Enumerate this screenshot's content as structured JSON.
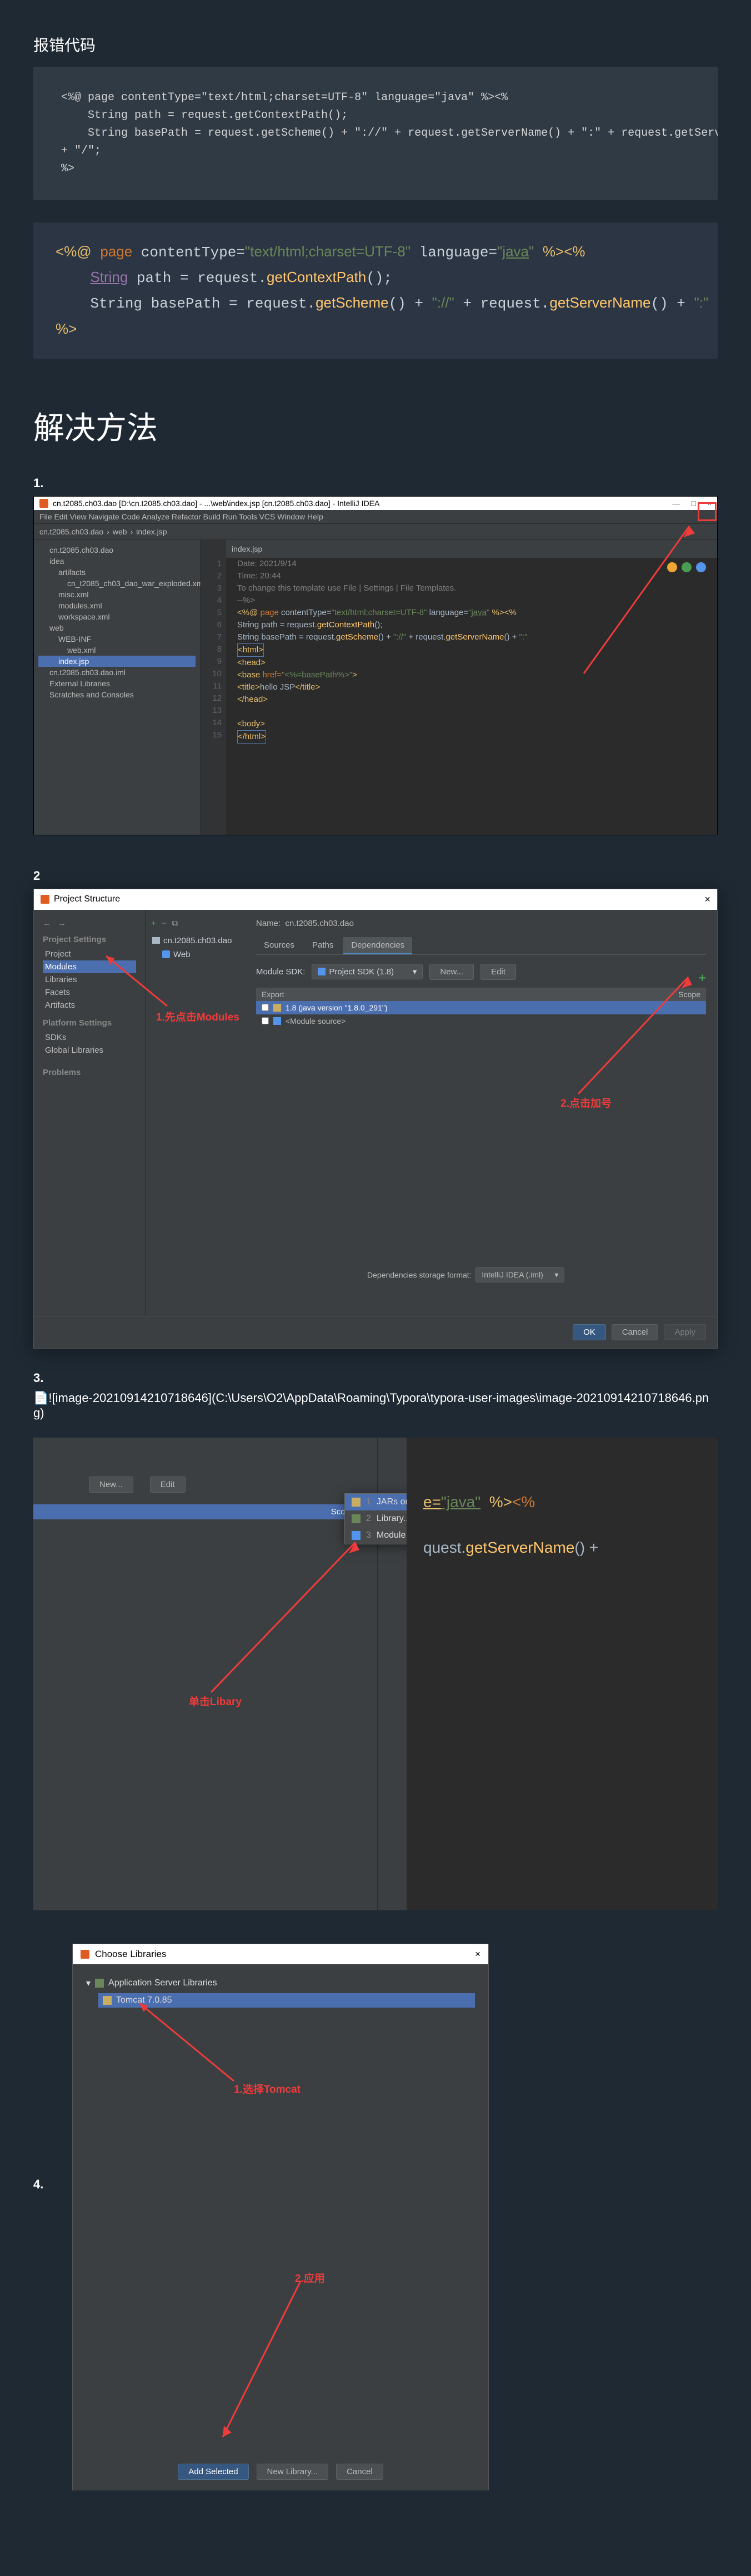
{
  "header_label": "报错代码",
  "code1": "<%@ page contentType=\"text/html;charset=UTF-8\" language=\"java\" %><%\n    String path = request.getContextPath();\n    String basePath = request.getScheme() + \"://\" + request.getServerName() + \":\" + request.getServerPort() + path\n+ \"/\";\n%>",
  "code2_html": "<span class='tag'>&lt;%@</span> <span class='kw'>page</span> contentType=<span class='str'>\"text/html;charset=UTF-8\"</span> language=<span class='str'>\"<u>java</u>\"</span> <span class='tag'>%&gt;</span><span class='tag'>&lt;%</span>\n    <span class='id'>String</span> path = request.<span class='fn'>getContextPath</span>();\n    String basePath = request.<span class='fn'>getScheme</span>() + <span class='str'>\"://\"</span> + request.<span class='fn'>getServerName</span>() + <span class='str'>\":\"</span>\n<span class='tag'>%&gt;</span>",
  "solution_title": "解决方法",
  "steps": {
    "s1": "1.",
    "s2": "2",
    "s3": "3.",
    "s4": "4."
  },
  "ide": {
    "title": "cn.t2085.ch03.dao [D:\\cn.t2085.ch03.dao] - ...\\web\\index.jsp [cn.t2085.ch03.dao] - IntelliJ IDEA",
    "menu": "File  Edit  View  Navigate  Code  Analyze  Refactor  Build  Run  Tools  VCS  Window  Help",
    "tab": "index.jsp",
    "tree": [
      "cn.t2085.ch03.dao",
      "idea",
      "artifacts",
      "cn_t2085_ch03_dao_war_exploded.xml",
      "misc.xml",
      "modules.xml",
      "workspace.xml",
      "web",
      "WEB-INF",
      "web.xml",
      "index.jsp",
      "cn.t2085.ch03.dao.iml",
      "External Libraries",
      "Scratches and Consoles"
    ],
    "gutter": [
      "1",
      "2",
      "3",
      "4",
      "5",
      "6",
      "7",
      "8",
      "9",
      "10",
      "11",
      "12",
      "13",
      "14",
      "15"
    ],
    "lines": [
      "<span class='cm'>Date: 2021/9/14</span>",
      "<span class='cm'>Time: 20:44</span>",
      "<span class='cm'>To change this template use File | Settings | File Templates.</span>",
      "<span class='cm'>--%&gt;</span>",
      "<span class='tag'>&lt;%@</span> <span class='kw'>page</span> contentType=<span class='str'>\"text/html;charset=UTF-8\"</span> language=<span class='str'>\"<u>java</u>\"</span> <span class='tag'>%&gt;&lt;%</span>",
      "    String path = request.<span class='fn'>getContextPath</span>();",
      "    String basePath = request.<span class='fn'>getScheme</span>() + <span class='str'>\"://\"</span> + request.<span class='fn'>getServerName</span>() + <span class='str'>\":\"</span>",
      "<span class='box'><span class='tag'>&lt;html&gt;</span></span>",
      "<span class='tag'>&lt;head&gt;</span>",
      "    <span class='tag'>&lt;base</span> <span class='kw'>href=</span><span class='str'>\"&lt;%=basePath%&gt;\"</span><span class='tag'>&gt;</span>",
      "    <span class='tag'>&lt;title&gt;</span>hello JSP<span class='tag'>&lt;/title&gt;</span>",
      "<span class='tag'>&lt;/head&gt;</span>",
      "",
      "<span class='tag'>&lt;body&gt;</span>",
      "<span class='box'><span class='tag'>&lt;/html&gt;</span></span>"
    ]
  },
  "ps": {
    "title": "Project Structure",
    "nav_settings": "Project Settings",
    "nav": [
      "Project",
      "Modules",
      "Libraries",
      "Facets",
      "Artifacts"
    ],
    "nav_platform": "Platform Settings",
    "nav2": [
      "SDKs",
      "Global Libraries"
    ],
    "nav_problems": "Problems",
    "module": "cn.t2085.ch03.dao",
    "module_sub": "Web",
    "name_label": "Name:",
    "name_val": "cn.t2085.ch03.dao",
    "tabs": [
      "Sources",
      "Paths",
      "Dependencies"
    ],
    "sdk_label": "Module SDK:",
    "sdk_val": "Project SDK (1.8)",
    "new": "New...",
    "edit": "Edit",
    "export": "Export",
    "scope": "Scope",
    "dep1": "1.8 (java version \"1.8.0_291\")",
    "dep2": "<Module source>",
    "storage": "Dependencies storage format:",
    "storage_val": "IntelliJ IDEA (.iml)",
    "ok": "OK",
    "cancel": "Cancel",
    "apply": "Apply",
    "anno1": "1.先点击Modules",
    "anno2": "2.点击加号"
  },
  "s3": {
    "imgtext": "![image-20210914210718646](C:\\Users\\O2\\AppData\\Roaming\\Typora\\typora-user-images\\image-20210914210718646.png)",
    "new": "New...",
    "edit": "Edit",
    "scope": "Scope",
    "popup": [
      "JARs or directories...",
      "Library...",
      "Module Dependency..."
    ],
    "anno": "单击Libary",
    "codeline1": "e=\"java\" %><%",
    "codeline2": "quest.getServerName() +"
  },
  "cl": {
    "title": "Choose Libraries",
    "x": "×",
    "group": "Application Server Libraries",
    "item": "Tomcat 7.0.85",
    "anno1": "1.选择Tomcat",
    "anno2": "2.应用",
    "add": "Add Selected",
    "newlib": "New Library...",
    "cancel": "Cancel"
  }
}
